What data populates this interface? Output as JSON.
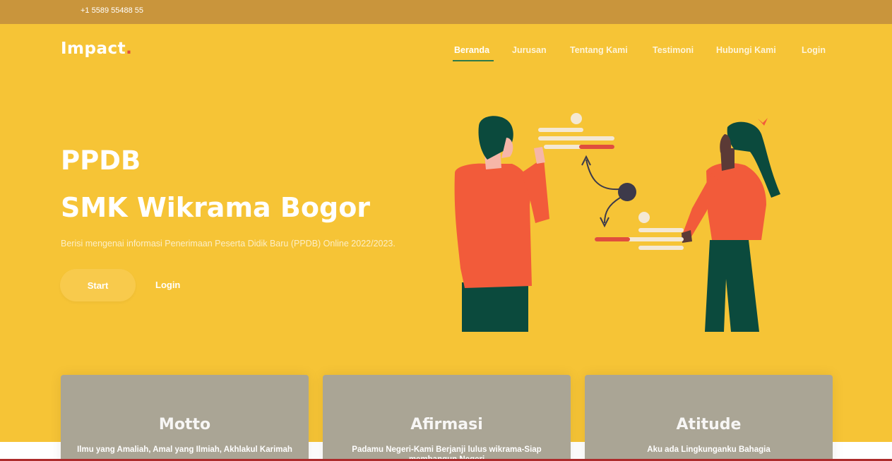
{
  "topbar": {
    "phone": "+1 5589 55488 55"
  },
  "brand": {
    "name": "Impact",
    "dot": "."
  },
  "nav": {
    "items": [
      {
        "label": "Beranda",
        "active": true
      },
      {
        "label": "Jurusan"
      },
      {
        "label": "Tentang Kami"
      },
      {
        "label": "Testimoni"
      },
      {
        "label": "Hubungi Kami"
      },
      {
        "label": "Login"
      }
    ]
  },
  "hero": {
    "title_line1": "PPDB",
    "title_line2": "SMK Wikrama Bogor",
    "description": "Berisi mengenai informasi Penerimaan Peserta Didik Baru (PPDB) Online 2022/2023.",
    "start_label": "Start",
    "login_label": "Login"
  },
  "cards": [
    {
      "title": "Motto",
      "text": "Ilmu yang Amaliah, Amal yang Ilmiah, Akhlakul Karimah"
    },
    {
      "title": "Afirmasi",
      "text": "Padamu Negeri-Kami Berjanji lulus wikrama-Siap membangun Negeri"
    },
    {
      "title": "Atitude",
      "text": "Aku ada Lingkunganku Bahagia"
    }
  ],
  "colors": {
    "topbar": "#c9953c",
    "hero": "#f6c436",
    "card": "#aaa595",
    "accent_red": "#e04e3d",
    "accent_green": "#2e7a4a"
  }
}
